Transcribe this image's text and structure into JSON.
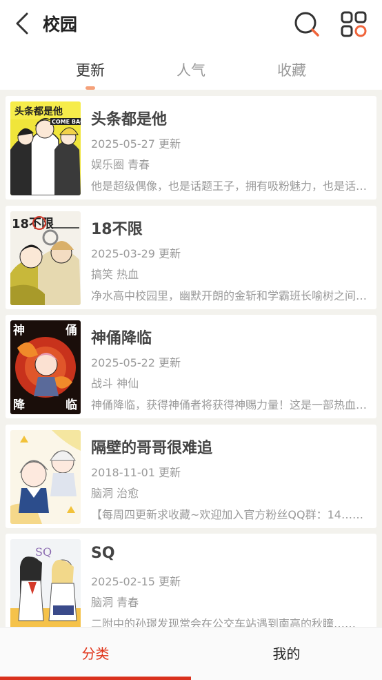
{
  "header": {
    "title": "校园",
    "icons": [
      "back-arrow-icon",
      "search-icon",
      "grid-menu-icon"
    ],
    "accent_color": "#f0643a"
  },
  "tabs": [
    {
      "label": "更新",
      "active": true
    },
    {
      "label": "人气",
      "active": false
    },
    {
      "label": "收藏",
      "active": false
    }
  ],
  "comics": [
    {
      "title": "头条都是他",
      "date": "2025-05-27 更新",
      "tags": "娱乐圈 青春",
      "desc": "他是超级偶像，也是话题王子，拥有吸粉魅力，也是话题制造机……",
      "cover_text": "头条都是他"
    },
    {
      "title": "18不限",
      "date": "2025-03-29 更新",
      "tags": "搞笑 热血",
      "desc": "净水高中校园里，幽默开朗的金斩和学霸班长喻树之间的故事……",
      "cover_text": "18不限"
    },
    {
      "title": "神俑降临",
      "date": "2025-05-22 更新",
      "tags": "战斗 神仙",
      "desc": "神俑降临，获得神俑者将获得神赐力量！这是一部热血战斗漫画……",
      "cover_text": "神俑降临"
    },
    {
      "title": "隔壁的哥哥很难追",
      "date": "2018-11-01 更新",
      "tags": "脑洞 治愈",
      "desc": "【每周四更新求收藏~欢迎加入官方粉丝QQ群：14……",
      "cover_text": ""
    },
    {
      "title": "SQ",
      "date": "2025-02-15 更新",
      "tags": "脑洞 青春",
      "desc": "二附中的孙璟发现常会在公交车站遇到南高的秋瞳……",
      "cover_text": "SQ"
    }
  ],
  "bottom_nav": [
    {
      "label": "分类",
      "active": true
    },
    {
      "label": "我的",
      "active": false
    }
  ]
}
